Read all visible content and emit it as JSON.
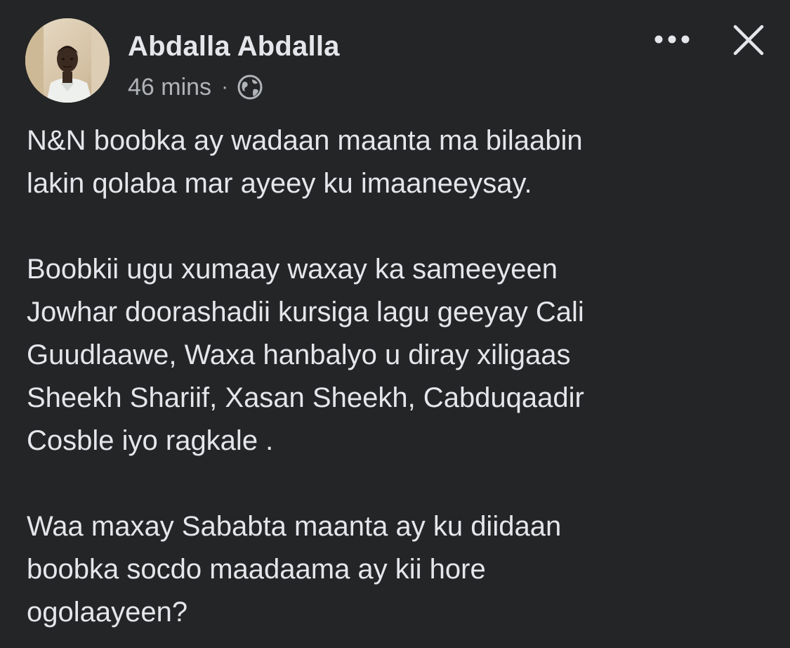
{
  "post": {
    "author": {
      "name": "Abdalla Abdalla",
      "avatar_icon": "profile-photo"
    },
    "timestamp": "46 mins",
    "separator": "·",
    "privacy_icon": "globe-icon",
    "actions": {
      "more_icon": "more-horizontal-icon",
      "close_icon": "close-icon"
    },
    "paragraphs": [
      "N&N boobka ay wadaan maanta ma bilaabin\nlakin qolaba mar ayeey ku imaaneeysay.",
      "Boobkii ugu xumaay waxay ka sameeyeen\nJowhar doorashadii kursiga lagu geeyay Cali\nGuudlaawe, Waxa hanbalyo u diray xiligaas\nSheekh Shariif, Xasan Sheekh, Cabduqaadir\nCosble iyo ragkale .",
      "Waa maxay Sababta maanta ay ku diidaan\nboobka socdo maadaama  ay kii hore\nogolaayeen?"
    ]
  },
  "colors": {
    "background": "#242526",
    "primary_text": "#e4e6eb",
    "secondary_text": "#b0b3b8"
  }
}
